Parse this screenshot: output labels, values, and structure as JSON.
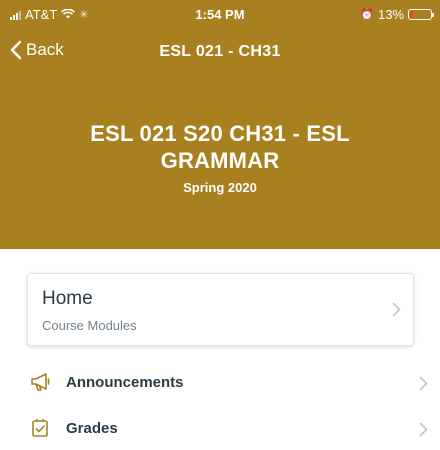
{
  "status_bar": {
    "carrier": "AT&T",
    "time": "1:54 PM",
    "battery": "13%"
  },
  "nav": {
    "back_label": "Back",
    "title": "ESL 021 - CH31"
  },
  "course": {
    "title": "ESL 021 S20 CH31 - ESL GRAMMAR",
    "term": "Spring 2020"
  },
  "home": {
    "title": "Home",
    "subtitle": "Course Modules"
  },
  "menu": [
    {
      "label": "Announcements",
      "icon": "megaphone-icon"
    },
    {
      "label": "Grades",
      "icon": "grades-icon"
    }
  ],
  "colors": {
    "header_bg": "#a98020",
    "icon_accent": "#a98020",
    "text_dark": "#2d3b45",
    "text_muted": "#73818c",
    "battery_low": "#ff3b30"
  }
}
